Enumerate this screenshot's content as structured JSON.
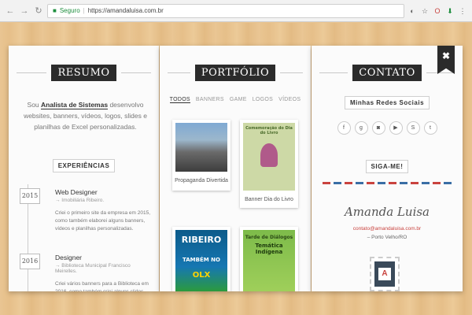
{
  "browser": {
    "secure_label": "Seguro",
    "url": "https://amandaluisa.com.br"
  },
  "resumo": {
    "heading": "RESUMO",
    "intro_pre": "Sou ",
    "intro_strong": "Analista de Sistemas",
    "intro_post": " desenvolvo websites, banners, vídeos, logos, slides e planilhas de Excel personalizadas.",
    "experiences_title": "EXPERIÊNCIAS",
    "experiences": [
      {
        "year": "2015",
        "role": "Web Designer",
        "org": "→ Imobiliária Ribeiro.",
        "desc": "Criei o primeiro site da empresa em 2015, como também elaborei alguns banners, vídeos e planilhas personalizadas."
      },
      {
        "year": "2016",
        "role": "Designer",
        "org": "→ Biblioteca Municipal Francisco Meirelles.",
        "desc": "Criei vários banners para a Biblioteca em 2016, como também criei alguns slides"
      }
    ]
  },
  "portfolio": {
    "heading": "PORTFÓLIO",
    "filters": [
      "TODOS",
      "BANNERS",
      "GAME",
      "LOGOS",
      "VÍDEOS"
    ],
    "items": [
      {
        "label": "Propaganda Divertida"
      },
      {
        "label": "Banner Dia do Livro",
        "thumb_text": "Comemoração do Dia do Livro"
      },
      {
        "label": "",
        "thumb_text_1": "RIBEIRO",
        "thumb_text_2": "TAMBÉM NO",
        "thumb_text_3": "OLX"
      },
      {
        "label": "",
        "thumb_text_1": "Tarde de Diálogos",
        "thumb_text_2": "Temática Indígena"
      }
    ]
  },
  "contato": {
    "heading": "CONTATO",
    "close_label": "✖",
    "social_title": "Minhas Redes Sociais",
    "socials": [
      {
        "icon": "facebook-icon",
        "glyph": "f"
      },
      {
        "icon": "google-plus-icon",
        "glyph": "g"
      },
      {
        "icon": "instagram-icon",
        "glyph": "◙"
      },
      {
        "icon": "youtube-icon",
        "glyph": "▶"
      },
      {
        "icon": "skype-icon",
        "glyph": "S"
      },
      {
        "icon": "tumblr-icon",
        "glyph": "t"
      }
    ],
    "follow_title": "SIGA-ME!",
    "signature": "Amanda Luisa",
    "email": "contato@amandaluisa.com.br",
    "city": "– Porto Velho/RO"
  }
}
